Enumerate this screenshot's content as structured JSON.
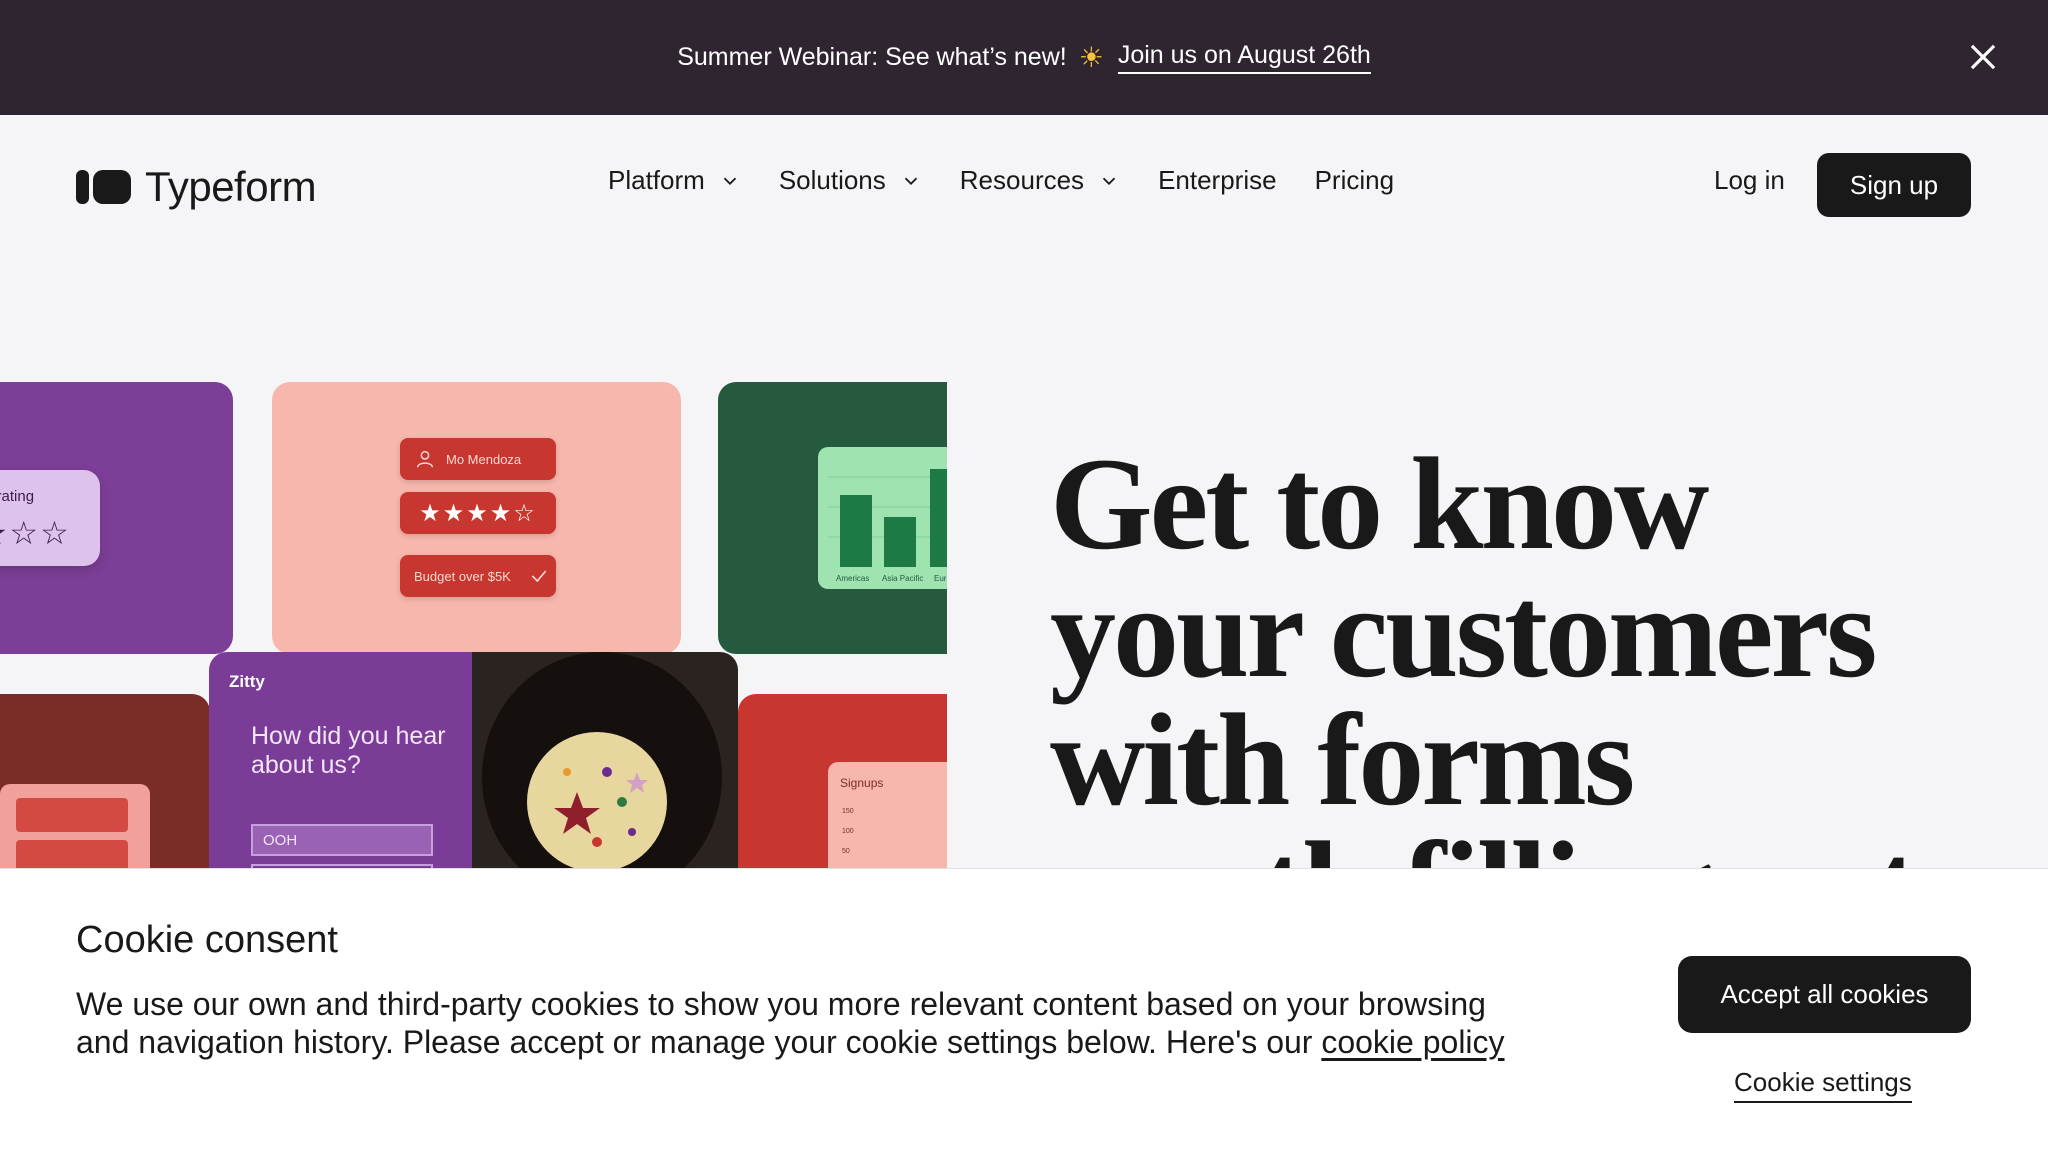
{
  "announcement": {
    "message": "Summer Webinar: See what’s new!",
    "emoji": "☀",
    "link_label": "Join us on August 26th",
    "close_icon": "close-icon"
  },
  "header": {
    "brand": "Typeform",
    "nav": [
      {
        "label": "Platform",
        "has_dropdown": true
      },
      {
        "label": "Solutions",
        "has_dropdown": true
      },
      {
        "label": "Resources",
        "has_dropdown": true
      },
      {
        "label": "Enterprise",
        "has_dropdown": false
      },
      {
        "label": "Pricing",
        "has_dropdown": false
      }
    ],
    "login_label": "Log in",
    "signup_label": "Sign up"
  },
  "collage": {
    "rating_label": "erage rating",
    "rating_stars": "★★☆☆",
    "name_pill": "Mo Mendoza",
    "stars_pill": "★★★★☆",
    "budget_pill": "Budget over $5K",
    "chart_labels": [
      "Americas",
      "Asia Pacific",
      "Euro"
    ],
    "zitty_logo": "Zitty",
    "zitty_question": "How did you hear about us?",
    "zitty_answer": "OOH",
    "signups_title": "Signups",
    "signups_ticks": [
      "150",
      "100",
      "50"
    ]
  },
  "hero": {
    "headline": "Get to know your customers with forms worth filling out"
  },
  "cookie": {
    "title": "Cookie consent",
    "body": "We use our own and third-party cookies to show you more relevant content based on your browsing and navigation history. Please accept or manage your cookie settings below. Here's our ",
    "policy_link": "cookie policy",
    "accept_label": "Accept all cookies",
    "settings_label": "Cookie settings"
  },
  "colors": {
    "announcement_bg": "#2e2531",
    "page_bg": "#f5f5f7",
    "primary_button": "#191919"
  }
}
